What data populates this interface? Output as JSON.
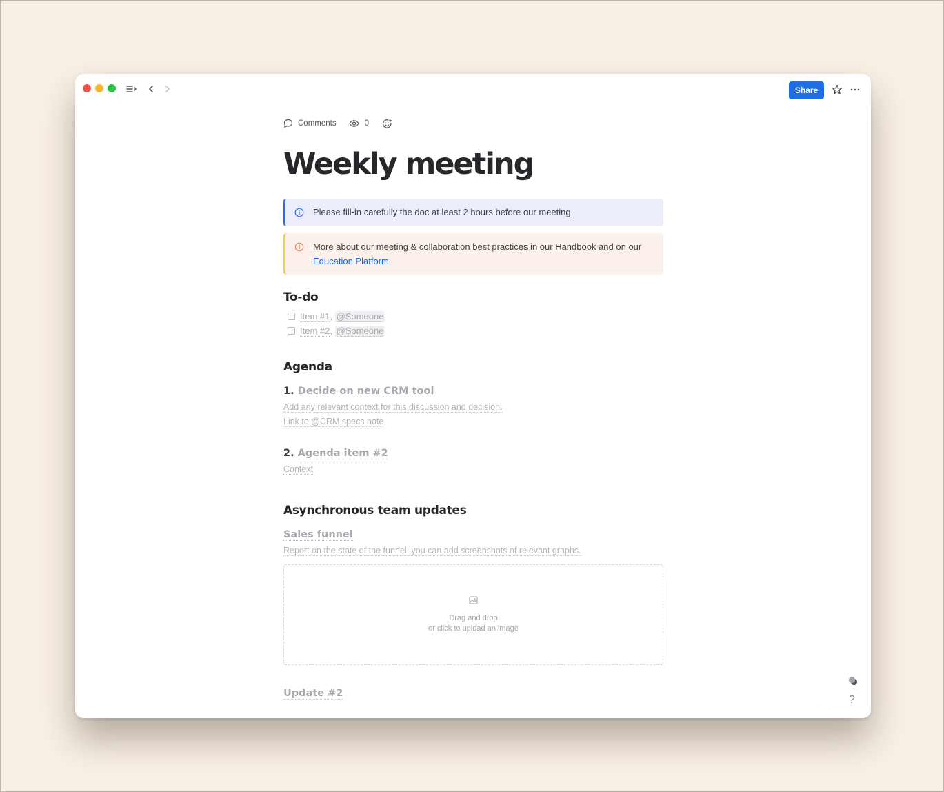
{
  "window": {
    "toolbar": {
      "share_label": "Share"
    }
  },
  "meta": {
    "comments_label": "Comments",
    "views_count": "0"
  },
  "page": {
    "title": "Weekly meeting"
  },
  "callouts": {
    "info": {
      "text": "Please fill-in carefully the doc at least 2 hours before our meeting",
      "accent": "#2d6ce0"
    },
    "warning": {
      "text": "More about our meeting & collaboration best practices in our Handbook and on our ",
      "link_text": "Education Platform",
      "accent": "#f7cb5c"
    }
  },
  "todo": {
    "heading": "To-do",
    "items": [
      {
        "label": "Item #1",
        "mention": "@Someone",
        "checked": false
      },
      {
        "label": "Item #2",
        "mention": "@Someone",
        "checked": false
      }
    ]
  },
  "agenda": {
    "heading": "Agenda",
    "items": [
      {
        "number": "1.",
        "title": "Decide on new CRM tool",
        "lines": [
          "Add any relevant context for this discussion and decision.",
          "Link to @CRM specs note"
        ]
      },
      {
        "number": "2.",
        "title": "Agenda item #2",
        "lines": [
          "Context"
        ]
      }
    ]
  },
  "updates": {
    "heading": "Asynchronous team updates",
    "items": [
      {
        "title": "Sales funnel",
        "description": "Report on the state of the funnel, you can add screenshots of relevant graphs."
      },
      {
        "title": "Update #2"
      }
    ],
    "upload": {
      "line1": "Drag and drop",
      "line2": "or click to upload an image"
    }
  },
  "help": {
    "label": "?"
  }
}
